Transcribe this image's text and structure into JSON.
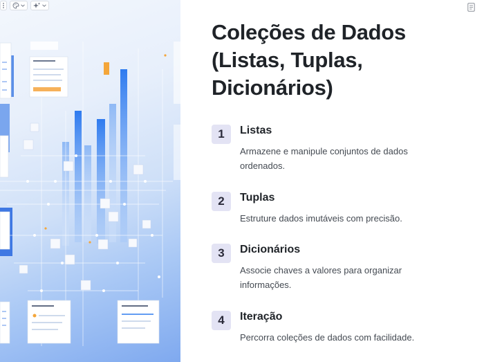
{
  "slide": {
    "title": "Coleções de Dados (Listas, Tuplas, Dicionários)",
    "items": [
      {
        "number": "1",
        "title": "Listas",
        "description": "Armazene e manipule conjuntos de dados ordenados."
      },
      {
        "number": "2",
        "title": "Tuplas",
        "description": "Estruture dados imutáveis com precisão."
      },
      {
        "number": "3",
        "title": "Dicionários",
        "description": "Associe chaves a valores para organizar informações."
      },
      {
        "number": "4",
        "title": "Iteração",
        "description": "Percorra coleções de dados com facilidade."
      }
    ]
  },
  "toolbar": {
    "icons": [
      "more-vertical-icon",
      "palette-icon",
      "sparkle-icon",
      "chevron-down-icon"
    ]
  },
  "doc_button": {
    "icon": "document-icon"
  },
  "colors": {
    "badge_bg": "#e3e3f4",
    "title": "#1f2328",
    "accent_blue": "#2f7bef"
  }
}
